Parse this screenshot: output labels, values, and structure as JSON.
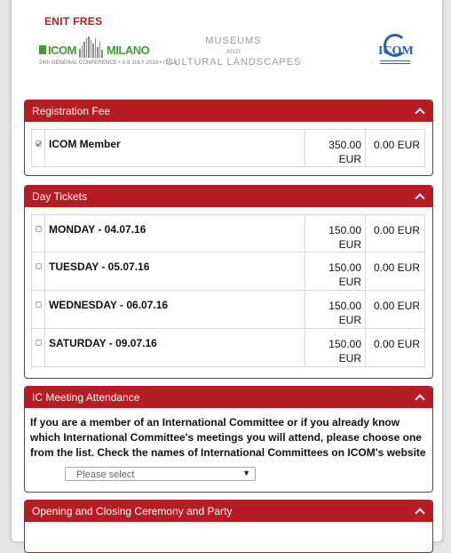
{
  "header": {
    "top_label": "ENIT FRES",
    "logo_left": {
      "year": "2016",
      "icom": "ICOM",
      "milano": "MILANO",
      "subtitle": "24th GENERAL CONFERENCE • 3-9 JULY 2016 • ITALY"
    },
    "title": {
      "line1": "MUSEUMS",
      "and": "AND",
      "line2": "CULTURAL LANDSCAPES"
    },
    "logo_right": {
      "text": "ICOM"
    }
  },
  "sections": {
    "registration_fee": {
      "title": "Registration Fee",
      "rows": [
        {
          "name": "ICOM Member",
          "price": "350.00",
          "currency": "EUR",
          "total": "0.00 EUR",
          "checked": true
        }
      ]
    },
    "day_tickets": {
      "title": "Day Tickets",
      "rows": [
        {
          "name": "MONDAY - 04.07.16",
          "price": "150.00",
          "currency": "EUR",
          "total": "0.00 EUR",
          "checked": false
        },
        {
          "name": "TUESDAY - 05.07.16",
          "price": "150.00",
          "currency": "EUR",
          "total": "0.00 EUR",
          "checked": false
        },
        {
          "name": "WEDNESDAY - 06.07.16",
          "price": "150.00",
          "currency": "EUR",
          "total": "0.00 EUR",
          "checked": false
        },
        {
          "name": "SATURDAY - 09.07.16",
          "price": "150.00",
          "currency": "EUR",
          "total": "0.00 EUR",
          "checked": false
        }
      ]
    },
    "ic_meeting": {
      "title": "IC Meeting Attendance",
      "description": "If you are a member of an International Committee or if you already know which International Committee's meetings you will attend, please choose one from the list. Check the names of International Committees on ICOM's website",
      "select_value": "Please select",
      "select_arrow": "▼"
    },
    "ceremony": {
      "title": "Opening and Closing Ceremony and Party"
    }
  },
  "colors": {
    "brand_red": "#b71c24",
    "icom_green": "#3f9c35",
    "icom_blue": "#2b5fa8"
  },
  "icons": [
    "chevron-up-icon",
    "checkbox-checked",
    "checkbox-unchecked",
    "dropdown-arrow-icon"
  ]
}
